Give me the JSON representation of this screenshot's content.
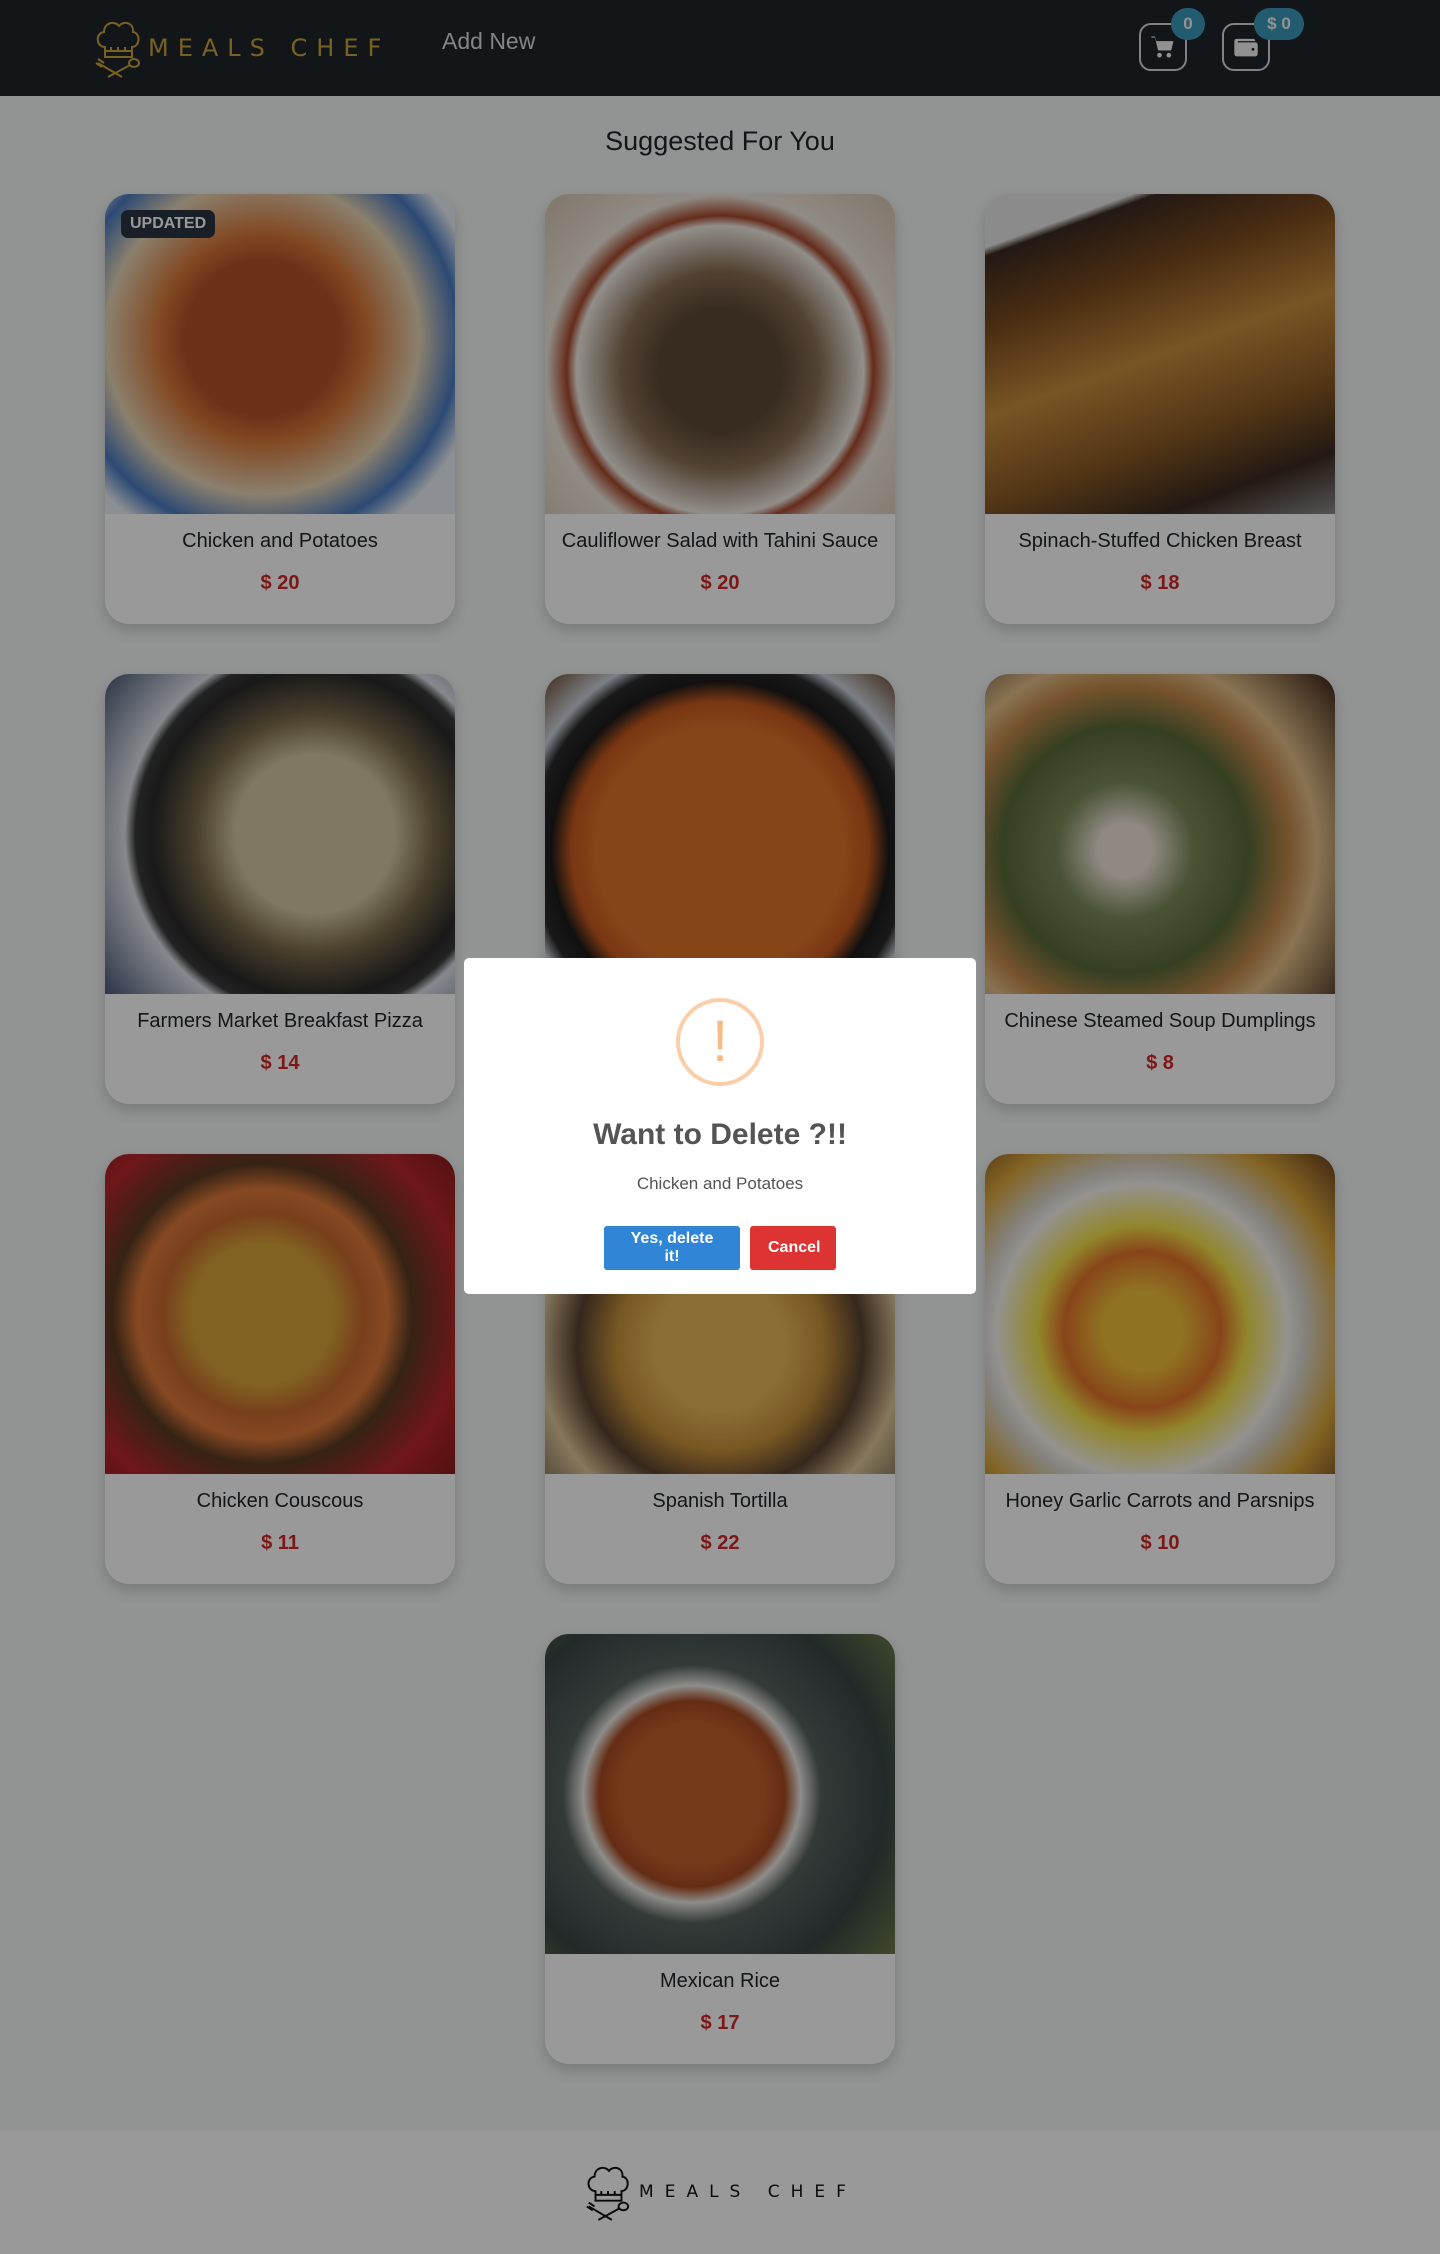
{
  "navbar": {
    "brand": "MEALS CHEF",
    "add_new_label": "Add New",
    "cart_count": "0",
    "wallet_balance": "$ 0",
    "brand_color": "#c9a23a"
  },
  "main": {
    "section_title": "Suggested For You",
    "meals": [
      {
        "name": "Chicken and Potatoes",
        "price": "$ 20",
        "ribbon": "UPDATED",
        "image": "roasted-chicken-photo"
      },
      {
        "name": "Cauliflower Salad with Tahini Sauce",
        "price": "$ 20",
        "image": "cauliflower-salad-photo"
      },
      {
        "name": "Spinach-Stuffed Chicken Breast",
        "price": "$ 18",
        "image": "stuffed-chicken-photo"
      },
      {
        "name": "Farmers Market Breakfast Pizza",
        "price": "$ 14",
        "image": "breakfast-pizza-photo"
      },
      {
        "name": "",
        "price": "",
        "image": "paella-photo"
      },
      {
        "name": "Chinese Steamed Soup Dumplings",
        "price": "$ 8",
        "image": "dumplings-photo"
      },
      {
        "name": "Chicken Couscous",
        "price": "$ 11",
        "image": "couscous-photo"
      },
      {
        "name": "Spanish Tortilla",
        "price": "$ 22",
        "image": "tortilla-photo"
      },
      {
        "name": "Honey Garlic Carrots and Parsnips",
        "price": "$ 10",
        "image": "carrots-parsnips-photo"
      },
      {
        "name": "Mexican Rice",
        "price": "$ 17",
        "image": "mexican-rice-photo"
      }
    ],
    "price_color": "#d32727"
  },
  "footer": {
    "brand": "MEALS CHEF"
  },
  "modal": {
    "icon": "!",
    "title": "Want to Delete ?!!",
    "text": "Chicken and Potatoes",
    "confirm_label": "Yes, delete it!",
    "cancel_label": "Cancel",
    "confirm_color": "#3085d6",
    "cancel_color": "#dd3333"
  }
}
